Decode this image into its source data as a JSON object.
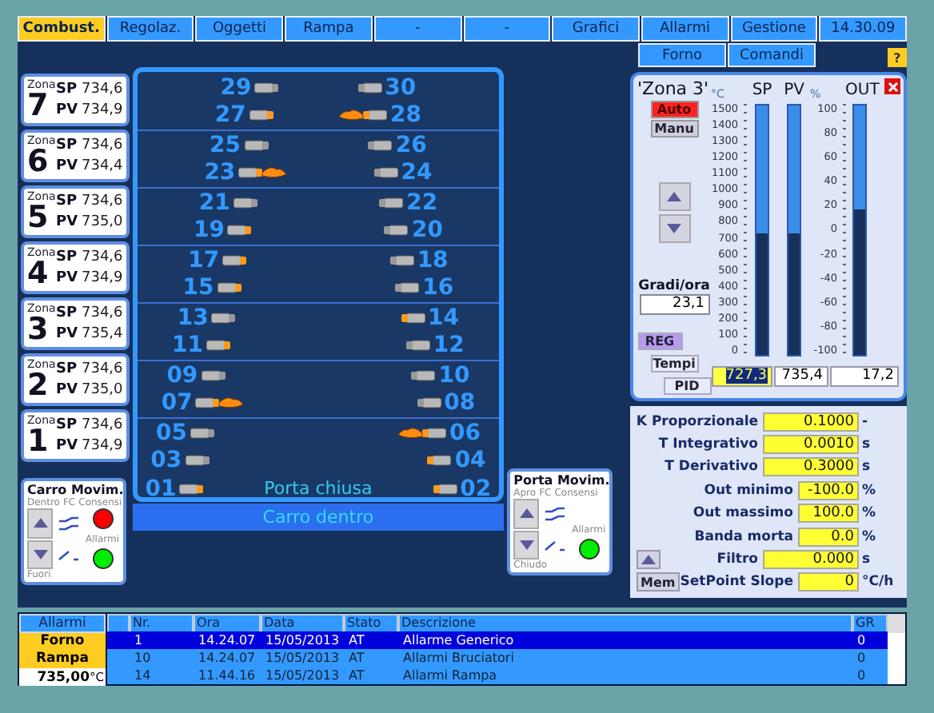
{
  "tabs": [
    {
      "label": "Combust.",
      "selected": true
    },
    {
      "label": "Regolaz.",
      "selected": false
    },
    {
      "label": "Oggetti",
      "selected": false
    },
    {
      "label": "Rampa",
      "selected": false
    },
    {
      "label": "-",
      "selected": false
    },
    {
      "label": "-",
      "selected": false
    },
    {
      "label": "Grafici",
      "selected": false
    },
    {
      "label": "Allarmi",
      "selected": false
    },
    {
      "label": "Gestione",
      "selected": false
    }
  ],
  "clock": "14.30.09",
  "subtabs": [
    {
      "label": "Forno",
      "selected": false
    },
    {
      "label": "Comandi",
      "selected": false
    }
  ],
  "help_button": "?",
  "zones": [
    {
      "label": "Zona",
      "number": "7",
      "sp_label": "SP",
      "sp": "734,6",
      "pv_label": "PV",
      "pv": "734,9",
      "rows": [
        [
          {
            "number": "29",
            "kind": "off"
          },
          {
            "number": "30",
            "kind": "off"
          }
        ],
        [
          {
            "number": "27",
            "kind": "on"
          },
          {
            "number": "28",
            "kind": "flame"
          }
        ]
      ]
    },
    {
      "label": "Zona",
      "number": "6",
      "sp_label": "SP",
      "sp": "734,6",
      "pv_label": "PV",
      "pv": "734,4",
      "rows": [
        [
          {
            "number": "25",
            "kind": "off"
          },
          {
            "number": "26",
            "kind": "off"
          }
        ],
        [
          {
            "number": "23",
            "kind": "flame"
          },
          {
            "number": "24",
            "kind": "off"
          }
        ]
      ]
    },
    {
      "label": "Zona",
      "number": "5",
      "sp_label": "SP",
      "sp": "734,6",
      "pv_label": "PV",
      "pv": "735,0",
      "rows": [
        [
          {
            "number": "21",
            "kind": "off"
          },
          {
            "number": "22",
            "kind": "off"
          }
        ],
        [
          {
            "number": "19",
            "kind": "on"
          },
          {
            "number": "20",
            "kind": "off"
          }
        ]
      ]
    },
    {
      "label": "Zona",
      "number": "4",
      "sp_label": "SP",
      "sp": "734,6",
      "pv_label": "PV",
      "pv": "734,9",
      "rows": [
        [
          {
            "number": "17",
            "kind": "on"
          },
          {
            "number": "18",
            "kind": "off"
          }
        ],
        [
          {
            "number": "15",
            "kind": "on"
          },
          {
            "number": "16",
            "kind": "off"
          }
        ]
      ]
    },
    {
      "label": "Zona",
      "number": "3",
      "sp_label": "SP",
      "sp": "734,6",
      "pv_label": "PV",
      "pv": "735,4",
      "rows": [
        [
          {
            "number": "13",
            "kind": "off"
          },
          {
            "number": "14",
            "kind": "on"
          }
        ],
        [
          {
            "number": "11",
            "kind": "on"
          },
          {
            "number": "12",
            "kind": "off"
          }
        ]
      ]
    },
    {
      "label": "Zona",
      "number": "2",
      "sp_label": "SP",
      "sp": "734,6",
      "pv_label": "PV",
      "pv": "735,0",
      "rows": [
        [
          {
            "number": "09",
            "kind": "off"
          },
          {
            "number": "10",
            "kind": "off"
          }
        ],
        [
          {
            "number": "07",
            "kind": "flame"
          },
          {
            "number": "08",
            "kind": "off"
          }
        ]
      ]
    },
    {
      "label": "Zona",
      "number": "1",
      "sp_label": "SP",
      "sp": "734,6",
      "pv_label": "PV",
      "pv": "734,9",
      "rows": [
        [
          {
            "number": "05",
            "kind": "off"
          },
          {
            "number": "06",
            "kind": "flame"
          }
        ],
        [
          {
            "number": "03",
            "kind": "off"
          },
          {
            "number": "04",
            "kind": "on"
          }
        ],
        [
          {
            "number": "01",
            "kind": "on"
          },
          {
            "number": "02",
            "kind": "on"
          }
        ]
      ]
    }
  ],
  "door_status": "Porta chiusa",
  "cart_status": "Carro dentro",
  "movers": [
    {
      "title": "Carro Movim.",
      "top_label": "Dentro",
      "fc_label": "FC",
      "ok_label": "Consensi",
      "alarm_label": "Allarmi",
      "bottom_label": "Fuori",
      "ok_lamp": {
        "color": "#ff0000"
      },
      "alarm_lamp": {
        "color": "#00ee00"
      }
    },
    {
      "title": "Porta Movim.",
      "top_label": "Apro",
      "fc_label": "FC",
      "ok_label": "Consensi",
      "alarm_label": "Allarmi",
      "bottom_label": "Chiudo",
      "alarm_lamp": {
        "color": "#00ee00"
      }
    }
  ],
  "zone_panel": {
    "title": "'Zona 3'",
    "modes": [
      {
        "label": "Auto",
        "selected": true
      },
      {
        "label": "Manu",
        "selected": false
      }
    ],
    "rate_label": "Gradi/ora",
    "rate_value": "23,1",
    "buttons": [
      {
        "label": "REG",
        "selected": true
      },
      {
        "label": "Tempi",
        "selected": false
      },
      {
        "label": "PID",
        "selected": false
      }
    ],
    "unit_temp": "°C",
    "unit_out": "%",
    "scale_temp": [
      "1500",
      "1400",
      "1300",
      "1200",
      "1100",
      "1000",
      "900",
      "800",
      "700",
      "600",
      "500",
      "400",
      "300",
      "200",
      "100",
      "0"
    ],
    "scale_out": [
      "100",
      "80",
      "60",
      "40",
      "20",
      "0",
      "-20",
      "-40",
      "-60",
      "-80",
      "-100"
    ],
    "meters": [
      {
        "name": "SP",
        "level": 0.485,
        "value": "727,3",
        "selected": true
      },
      {
        "name": "PV",
        "level": 0.49,
        "value": "735,4",
        "selected": false
      },
      {
        "name": "OUT",
        "level": 0.586,
        "value": "17,2",
        "selected": false
      }
    ]
  },
  "params": [
    {
      "label": "K Proporzionale",
      "value": "0.1000",
      "unit": "-",
      "kind": "wide"
    },
    {
      "label": "T Integrativo",
      "value": "0.0010",
      "unit": "s",
      "kind": "wide"
    },
    {
      "label": "T Derivativo",
      "value": "0.3000",
      "unit": "s",
      "kind": "wide"
    },
    {
      "label": "Out minimo",
      "value": "-100.0",
      "unit": "%",
      "kind": "narrow"
    },
    {
      "label": "Out massimo",
      "value": "100.0",
      "unit": "%",
      "kind": "narrow"
    },
    {
      "label": "Banda morta",
      "value": "0.0",
      "unit": "%",
      "kind": "narrow"
    },
    {
      "label": "Filtro",
      "value": "0.000",
      "unit": "s",
      "kind": "wide"
    },
    {
      "label": "SetPoint Slope",
      "value": "0",
      "unit": "°C/h",
      "kind": "narrow"
    }
  ],
  "mem_button": "Mem",
  "alarms": {
    "title": "Allarmi",
    "groups": [
      "Forno",
      "Rampa"
    ],
    "temperature": "735,00",
    "unit": "°C",
    "columns": [
      "Nr.",
      "Ora",
      "Data",
      "Stato",
      "Descrizione",
      "GR"
    ],
    "rows": [
      {
        "cells": [
          "1",
          "14.24.07",
          "15/05/2013",
          "AT",
          "Allarme Generico",
          "0"
        ],
        "selected": true
      },
      {
        "cells": [
          "10",
          "14.24.07",
          "15/05/2013",
          "AT",
          "Allarmi Bruciatori",
          "0"
        ],
        "selected": false
      },
      {
        "cells": [
          "14",
          "11.44.16",
          "15/05/2013",
          "AT",
          "Allarmi Rampa",
          "0"
        ],
        "selected": false
      }
    ]
  }
}
